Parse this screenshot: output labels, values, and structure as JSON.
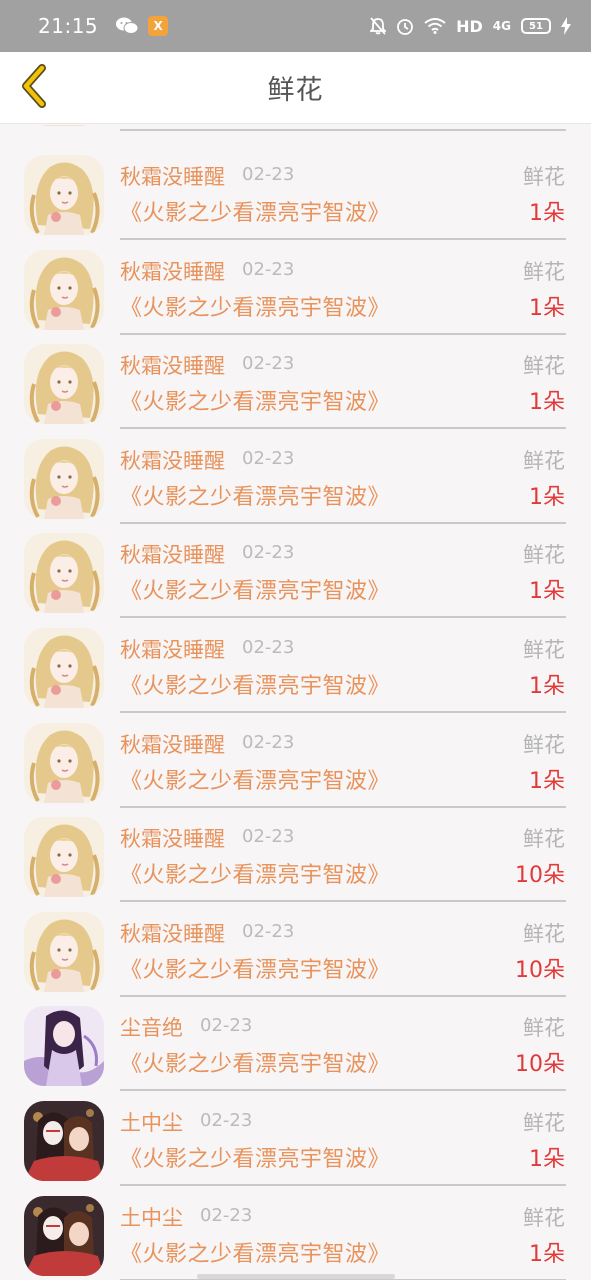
{
  "status_bar": {
    "time": "21:15",
    "app_badge": "X",
    "hd": "HD",
    "network": "4G",
    "battery": "51"
  },
  "header": {
    "title": "鲜花",
    "back_icon": "chevron-left-icon",
    "accent_color": "#f0c20a"
  },
  "colors": {
    "name": "#e8935c",
    "count": "#e03a3a",
    "muted": "#bbbbbb"
  },
  "items": [
    {
      "name": "秋霜没睡醒",
      "date": "02-23",
      "book": "《火影之少看漂亮宇智波》",
      "type": "鲜花",
      "count": "1朵",
      "avatar": "blonde-girl-avatar"
    },
    {
      "name": "秋霜没睡醒",
      "date": "02-23",
      "book": "《火影之少看漂亮宇智波》",
      "type": "鲜花",
      "count": "1朵",
      "avatar": "blonde-girl-avatar"
    },
    {
      "name": "秋霜没睡醒",
      "date": "02-23",
      "book": "《火影之少看漂亮宇智波》",
      "type": "鲜花",
      "count": "1朵",
      "avatar": "blonde-girl-avatar"
    },
    {
      "name": "秋霜没睡醒",
      "date": "02-23",
      "book": "《火影之少看漂亮宇智波》",
      "type": "鲜花",
      "count": "1朵",
      "avatar": "blonde-girl-avatar"
    },
    {
      "name": "秋霜没睡醒",
      "date": "02-23",
      "book": "《火影之少看漂亮宇智波》",
      "type": "鲜花",
      "count": "1朵",
      "avatar": "blonde-girl-avatar"
    },
    {
      "name": "秋霜没睡醒",
      "date": "02-23",
      "book": "《火影之少看漂亮宇智波》",
      "type": "鲜花",
      "count": "1朵",
      "avatar": "blonde-girl-avatar"
    },
    {
      "name": "秋霜没睡醒",
      "date": "02-23",
      "book": "《火影之少看漂亮宇智波》",
      "type": "鲜花",
      "count": "1朵",
      "avatar": "blonde-girl-avatar"
    },
    {
      "name": "秋霜没睡醒",
      "date": "02-23",
      "book": "《火影之少看漂亮宇智波》",
      "type": "鲜花",
      "count": "10朵",
      "avatar": "blonde-girl-avatar"
    },
    {
      "name": "秋霜没睡醒",
      "date": "02-23",
      "book": "《火影之少看漂亮宇智波》",
      "type": "鲜花",
      "count": "10朵",
      "avatar": "blonde-girl-avatar"
    },
    {
      "name": "尘音绝",
      "date": "02-23",
      "book": "《火影之少看漂亮宇智波》",
      "type": "鲜花",
      "count": "10朵",
      "avatar": "purple-girl-avatar"
    },
    {
      "name": "土中尘",
      "date": "02-23",
      "book": "《火影之少看漂亮宇智波》",
      "type": "鲜花",
      "count": "1朵",
      "avatar": "masked-couple-avatar"
    },
    {
      "name": "土中尘",
      "date": "02-23",
      "book": "《火影之少看漂亮宇智波》",
      "type": "鲜花",
      "count": "1朵",
      "avatar": "masked-couple-avatar"
    }
  ]
}
